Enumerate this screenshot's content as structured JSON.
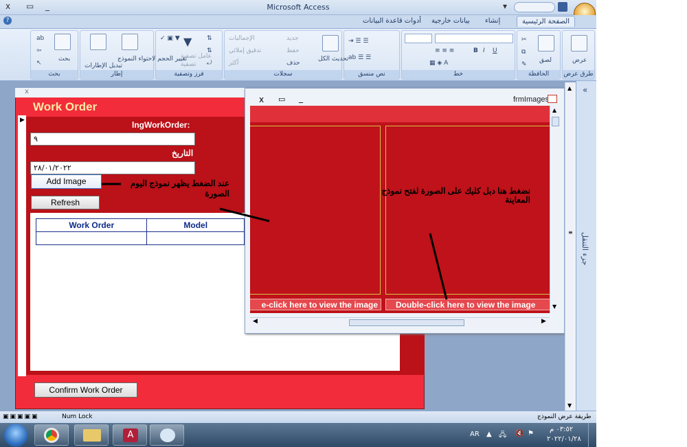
{
  "window": {
    "title": "Microsoft Access",
    "close_symbol": "x",
    "restore_symbol": "▭",
    "minimize_symbol": "_"
  },
  "ribbon_tabs": [
    {
      "label": "الصفحة الرئيسية",
      "active": true
    },
    {
      "label": "إنشاء",
      "active": false
    },
    {
      "label": "بيانات خارجية",
      "active": false
    },
    {
      "label": "أدوات قاعدة البيانات",
      "active": false
    }
  ],
  "ribbon_groups": {
    "views": {
      "label": "طرق عرض",
      "button": "عرض"
    },
    "clipboard": {
      "label": "الحافظة",
      "paste": "لصق"
    },
    "font": {
      "label": "خط"
    },
    "rich_text": {
      "label": "نص منسق"
    },
    "records": {
      "label": "سجلات",
      "refresh": "تحديث الكل",
      "new": "جديد",
      "save": "حفظ",
      "delete": "حذف",
      "totals": "الإجماليات",
      "spelling": "تدقيق إملائي",
      "more": "أكثر"
    },
    "sort_filter": {
      "label": "فرز وتصفية",
      "filter": "تصفية",
      "filter_toggle": "عامل تصفية"
    },
    "window": {
      "label": "إطار",
      "size_to_fit": "تغيير الحجم لاحتواء النموذج",
      "switch": "تبديل الإطارات"
    },
    "find": {
      "label": "بحث",
      "find": "بحث"
    }
  },
  "form": {
    "heading": "Work Order",
    "work_order_label": "lngWorkOrder:",
    "work_order_value": "٩",
    "date_label": "التاريخ",
    "date_value": "٢٨/٠١/٢٠٢٢",
    "add_image_button": "Add Image",
    "refresh_button": "Refresh",
    "confirm_button": "Confirm Work Order",
    "table_headers": [
      "Work Order",
      "Model"
    ]
  },
  "annotations": {
    "left": "عند الضغط يظهر نموذج اليوم الصورة",
    "middle": "نضغط هنا دبل كليك على الصورة لفتح نموذج المعاينة"
  },
  "image_window": {
    "title": "frmImages",
    "caption_left": "e-click here to view the image",
    "caption_right": "Double-click here to view the image"
  },
  "nav_pane": {
    "label": "جزء التنقل",
    "collapse_symbol": "«"
  },
  "status_bar": {
    "left": "طريقة عرض النموذج",
    "right": "Num Lock"
  },
  "tray": {
    "lang": "AR",
    "time": "٠٣:٥٢ م",
    "date": "٢٠٢٢/٠١/٢٨"
  }
}
